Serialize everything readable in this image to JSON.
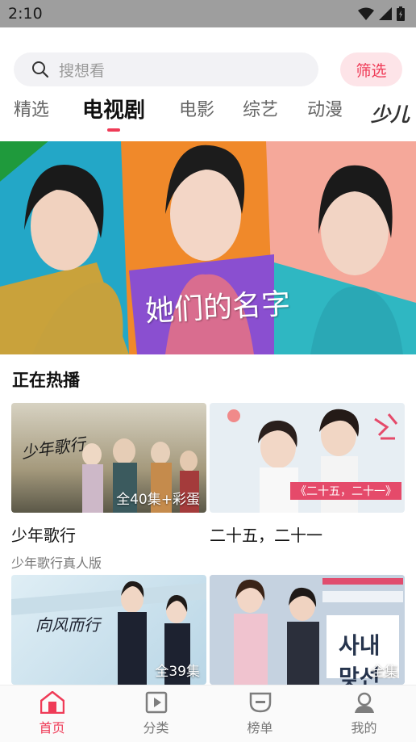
{
  "status_bar": {
    "time": "2:10"
  },
  "search": {
    "placeholder": "搜想看",
    "filter_label": "筛选"
  },
  "tabs": [
    {
      "label": "精选"
    },
    {
      "label": "电视剧",
      "active": true
    },
    {
      "label": "电影"
    },
    {
      "label": "综艺"
    },
    {
      "label": "动漫"
    },
    {
      "label": "少儿"
    }
  ],
  "banner": {
    "title": "她们的名字"
  },
  "section": {
    "title": "正在热播"
  },
  "cards": [
    {
      "title": "少年歌行",
      "subtitle": "少年歌行真人版",
      "badge": "全40集+彩蛋",
      "poster_text": "少年歌行"
    },
    {
      "title": "二十五，二十一",
      "subtitle": "",
      "badge": "",
      "poster_text": "《二十五，二十一》"
    },
    {
      "title": "",
      "subtitle": "",
      "badge": "全39集",
      "poster_text": "向风而行"
    },
    {
      "title": "",
      "subtitle": "",
      "badge": "全集",
      "poster_text": "사내 맞선"
    }
  ],
  "bottom_nav": [
    {
      "label": "首页",
      "icon": "home-icon",
      "active": true
    },
    {
      "label": "分类",
      "icon": "play-box-icon"
    },
    {
      "label": "榜单",
      "icon": "rank-icon"
    },
    {
      "label": "我的",
      "icon": "profile-icon"
    }
  ],
  "colors": {
    "accent": "#ef3b57",
    "status_bar": "#9e9e9e"
  }
}
